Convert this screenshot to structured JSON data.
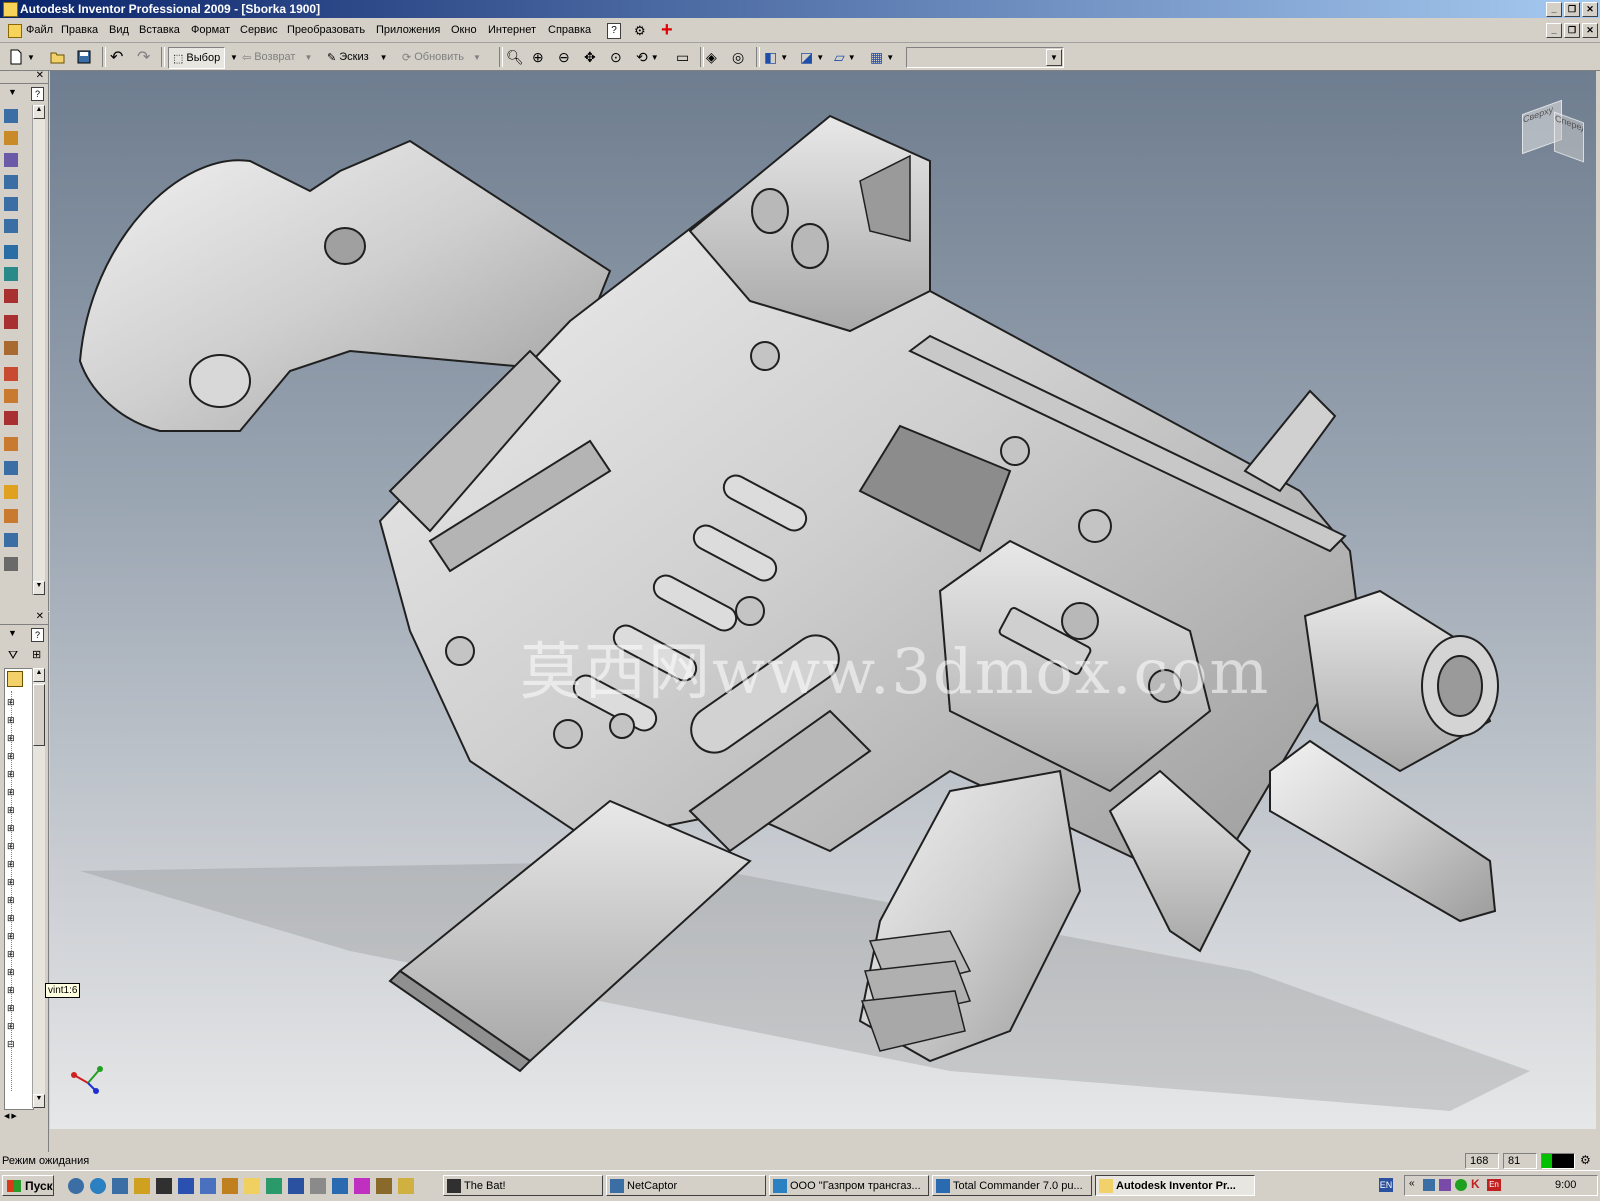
{
  "window": {
    "title": "Autodesk Inventor Professional 2009 - [Sborka 1900]"
  },
  "menu": [
    "Файл",
    "Правка",
    "Вид",
    "Вставка",
    "Формат",
    "Сервис",
    "Преобразовать",
    "Приложения",
    "Окно",
    "Интернет",
    "Справка"
  ],
  "toolbar": {
    "select_label": "Выбор",
    "return_label": "Возврат",
    "sketch_label": "Эскиз",
    "update_label": "Обновить"
  },
  "viewcube": {
    "face1": "Сверху",
    "face2": "Спереди"
  },
  "viewport": {
    "watermark": "莫西网www.3dmox.com",
    "tooltip": "vint1:6"
  },
  "status": {
    "text": "Режим ожидания",
    "num1": "168",
    "num2": "81"
  },
  "taskbar": {
    "start": "Пуск",
    "tasks": [
      "The Bat!",
      "NetCaptor",
      "ООО \"Газпром трансгаз...",
      "Total Commander 7.0 pu...",
      "Autodesk Inventor Pr..."
    ],
    "lang": "EN",
    "clock": "9:00"
  },
  "colors": {
    "title_start": "#0a246a",
    "title_end": "#a6caf0",
    "bg_top": "#6e7d8f",
    "bg_bottom": "#e6e7e8"
  }
}
